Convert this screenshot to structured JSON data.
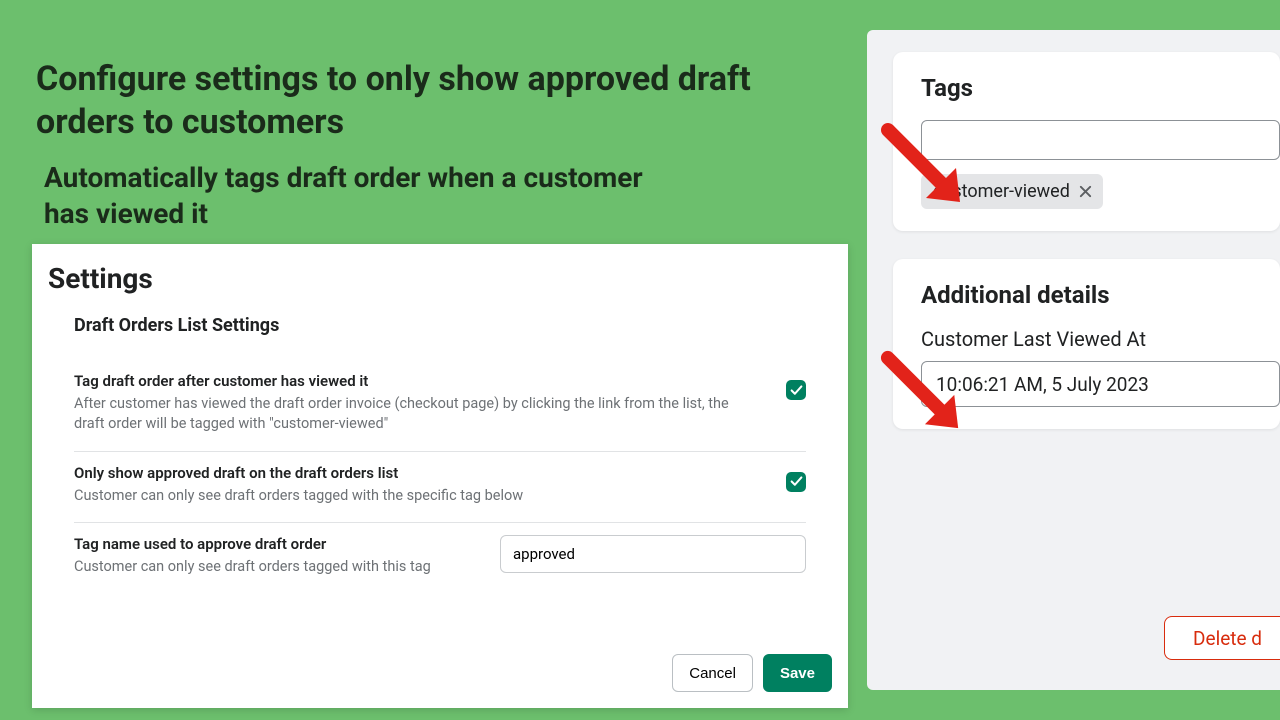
{
  "headline": "Configure settings to only show approved draft orders to customers",
  "subhead": "Automatically tags draft order when a customer has viewed it",
  "settings": {
    "panel_title": "Settings",
    "section_title": "Draft Orders List Settings",
    "row1": {
      "label": "Tag draft order after customer has viewed it",
      "desc": "After customer has viewed the draft order invoice (checkout page) by clicking the link from the list, the draft order will be tagged with \"customer-viewed\""
    },
    "row2": {
      "label": "Only show approved draft on the draft orders list",
      "desc": "Customer can only see draft orders tagged with the specific tag below"
    },
    "row3": {
      "label": "Tag name used to approve draft order",
      "desc": "Customer can only see draft orders tagged with this tag",
      "value": "approved"
    },
    "cancel": "Cancel",
    "save": "Save"
  },
  "tags_card": {
    "title": "Tags",
    "chip": "customer-viewed"
  },
  "details_card": {
    "title": "Additional details",
    "label": "Customer Last Viewed At",
    "value": "10:06:21 AM, 5 July 2023"
  },
  "delete_text": "Delete d"
}
